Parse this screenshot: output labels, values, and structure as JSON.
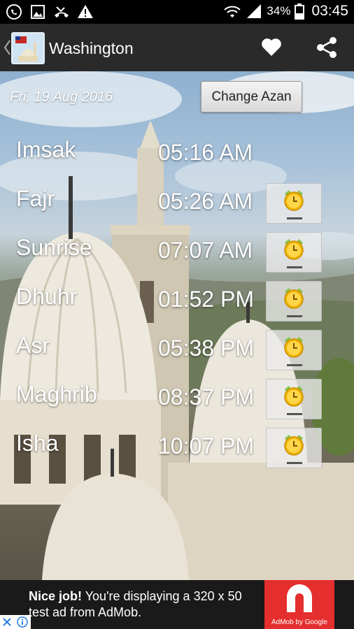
{
  "status_bar": {
    "battery_percent": "34%",
    "time": "03:45",
    "icons": [
      "whatsapp-icon",
      "image-icon",
      "missed-call-icon",
      "warning-icon",
      "wifi-icon",
      "signal-icon",
      "battery-icon"
    ]
  },
  "action_bar": {
    "title": "Washington",
    "icons": [
      "back-icon",
      "app-icon",
      "heart-icon",
      "share-icon"
    ]
  },
  "main": {
    "date": "Fri, 19 Aug 2016",
    "change_azan_label": "Change Azan",
    "prayers": [
      {
        "name": "Imsak",
        "time": "05:16 AM",
        "has_alarm": false
      },
      {
        "name": "Fajr",
        "time": "05:26 AM",
        "has_alarm": true
      },
      {
        "name": "Sunrise",
        "time": "07:07 AM",
        "has_alarm": true
      },
      {
        "name": "Dhuhr",
        "time": "01:52 PM",
        "has_alarm": true
      },
      {
        "name": "Asr",
        "time": "05:38 PM",
        "has_alarm": true
      },
      {
        "name": "Maghrib",
        "time": "08:37 PM",
        "has_alarm": true
      },
      {
        "name": "Isha",
        "time": "10:07 PM",
        "has_alarm": true
      }
    ]
  },
  "ad": {
    "headline": "Nice job!",
    "body": " You're displaying a 320 x 50 test ad from AdMob.",
    "logo_caption": "AdMob by Google",
    "info_icons": [
      "close-x-icon",
      "info-icon"
    ]
  },
  "colors": {
    "action_bar": "#2a2a2a",
    "status_bar": "#000000",
    "alarm_icon": "#f2b705",
    "alarm_bell_green": "#8bc34a",
    "admob_red": "#e52e2e"
  }
}
